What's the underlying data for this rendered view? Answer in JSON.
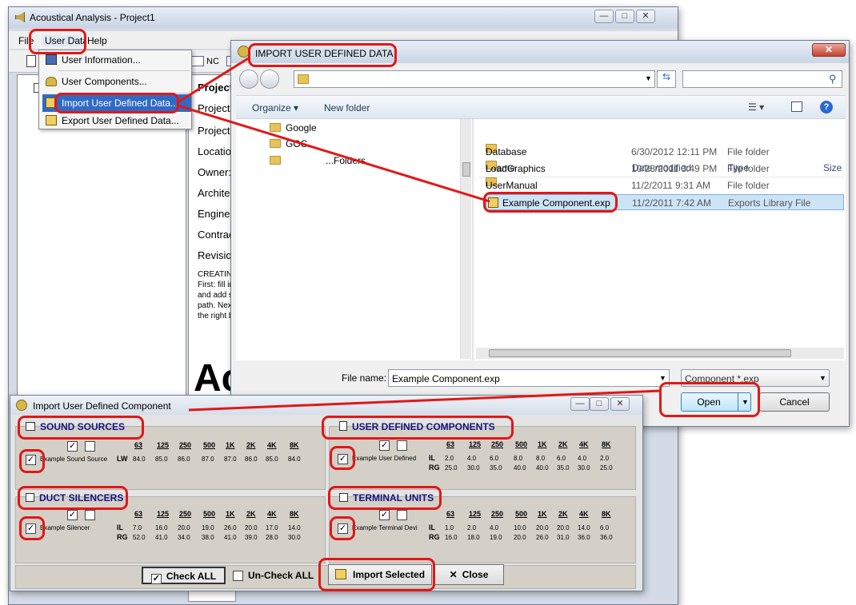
{
  "main_window": {
    "title": "Acoustical Analysis - Project1",
    "menu": {
      "file": "File",
      "user_data": "User Data",
      "help": "Help"
    },
    "toolbar_nc": "NC",
    "user_data_menu": [
      "User Information...",
      "User Components...",
      "Import User Defined Data...",
      "Export User Defined Data..."
    ],
    "project_labels": [
      "Project",
      "Project",
      "Project",
      "Location",
      "Owner:",
      "Archite",
      "Enginee",
      "Contrac",
      "Revisio"
    ],
    "creating_text": [
      "CREATIN",
      "First: fill in",
      "and add s",
      "path. Next",
      "the right b"
    ],
    "big_text": "Ac"
  },
  "file_dialog": {
    "title": "IMPORT USER DEFINED DATA",
    "search_placeholder": "",
    "organize": "Organize",
    "new_folder": "New folder",
    "tree": [
      "Google",
      "GOC",
      "...Folders"
    ],
    "columns": {
      "name": "Name",
      "date": "Date modified",
      "type": "Type",
      "size": "Size"
    },
    "files": [
      {
        "name": "Database",
        "date": "6/30/2012 12:11 PM",
        "type": "File folder"
      },
      {
        "name": "LoadGraphics",
        "date": "10/28/2011 3:49 PM",
        "type": "File folder"
      },
      {
        "name": "UserManual",
        "date": "11/2/2011 9:31 AM",
        "type": "File folder"
      },
      {
        "name": "Example Component.exp",
        "date": "11/2/2011 7:42 AM",
        "type": "Exports Library File"
      }
    ],
    "file_name_label": "File name:",
    "file_name_value": "Example Component.exp",
    "filter": "Component *.exp",
    "open_label": "Open",
    "cancel_label": "Cancel"
  },
  "import_dialog": {
    "title": "Import User Defined Component",
    "freqs": [
      "63",
      "125",
      "250",
      "500",
      "1K",
      "2K",
      "4K",
      "8K"
    ],
    "sound_sources": {
      "heading": "SOUND SOURCES",
      "item": "Example Sound Source",
      "row_label": "LW",
      "values": [
        "84.0",
        "85.0",
        "86.0",
        "87.0",
        "87.0",
        "86.0",
        "85.0",
        "84.0"
      ]
    },
    "user_defined": {
      "heading": "USER DEFINED COMPONENTS",
      "item": "Example User Defined",
      "il_label": "IL",
      "rg_label": "RG",
      "il": [
        "2.0",
        "4.0",
        "6.0",
        "8.0",
        "8.0",
        "6.0",
        "4.0",
        "2.0"
      ],
      "rg": [
        "25.0",
        "30.0",
        "35.0",
        "40.0",
        "40.0",
        "35.0",
        "30.0",
        "25.0"
      ]
    },
    "duct_silencers": {
      "heading": "DUCT SILENCERS",
      "item": "Example Silencer",
      "il_label": "IL",
      "rg_label": "RG",
      "il": [
        "7.0",
        "16.0",
        "20.0",
        "19.0",
        "26.0",
        "20.0",
        "17.0",
        "14.0"
      ],
      "rg": [
        "52.0",
        "41.0",
        "34.0",
        "38.0",
        "41.0",
        "39.0",
        "28.0",
        "30.0"
      ]
    },
    "terminal_units": {
      "heading": "TERMINAL UNITS",
      "item": "Example Terminal Devi",
      "il_label": "IL",
      "rg_label": "RG",
      "il": [
        "1.0",
        "2.0",
        "4.0",
        "10.0",
        "20.0",
        "20.0",
        "14.0",
        "6.0"
      ],
      "rg": [
        "16.0",
        "18.0",
        "19.0",
        "20.0",
        "26.0",
        "31.0",
        "36.0",
        "36.0"
      ]
    },
    "check_all": "Check ALL",
    "uncheck_all": "Un-Check ALL",
    "import_selected": "Import Selected",
    "close": "Close"
  },
  "colors": {
    "highlight": "#e01818",
    "selection": "#cfe3f7",
    "heading": "#14147a"
  }
}
